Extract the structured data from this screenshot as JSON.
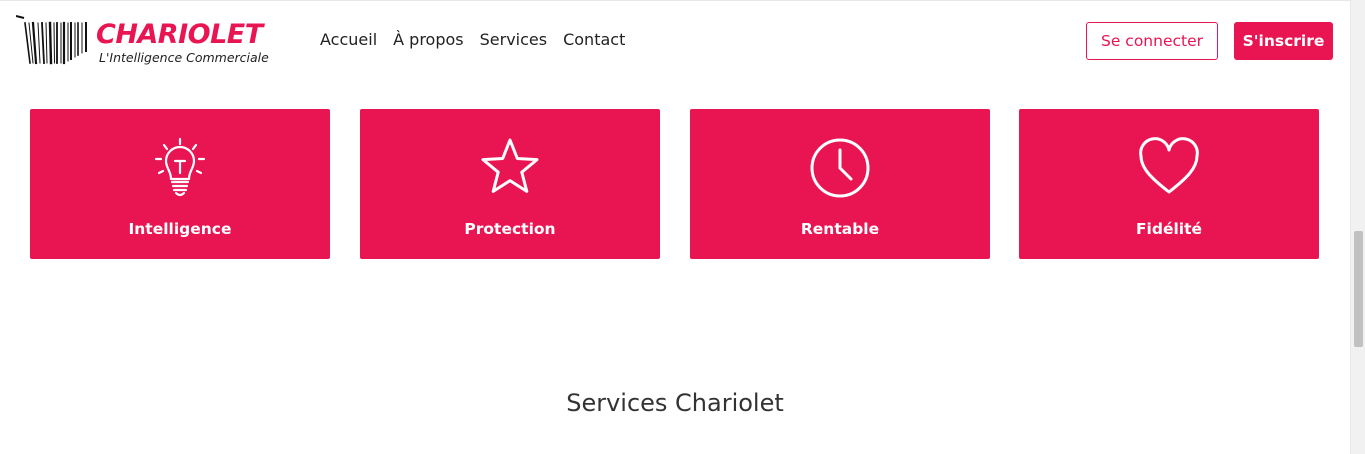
{
  "brand": {
    "name": "CHARIOLET",
    "tagline": "L'Intelligence Commerciale",
    "accent_color": "#e91553"
  },
  "nav": {
    "items": [
      {
        "label": "Accueil"
      },
      {
        "label": "À propos"
      },
      {
        "label": "Services"
      },
      {
        "label": "Contact"
      }
    ]
  },
  "auth": {
    "login_label": "Se connecter",
    "signup_label": "S'inscrire"
  },
  "features": [
    {
      "label": "Intelligence",
      "icon": "lightbulb-icon"
    },
    {
      "label": "Protection",
      "icon": "star-icon"
    },
    {
      "label": "Rentable",
      "icon": "clock-icon"
    },
    {
      "label": "Fidélité",
      "icon": "heart-icon"
    }
  ],
  "section": {
    "title": "Services Chariolet"
  }
}
